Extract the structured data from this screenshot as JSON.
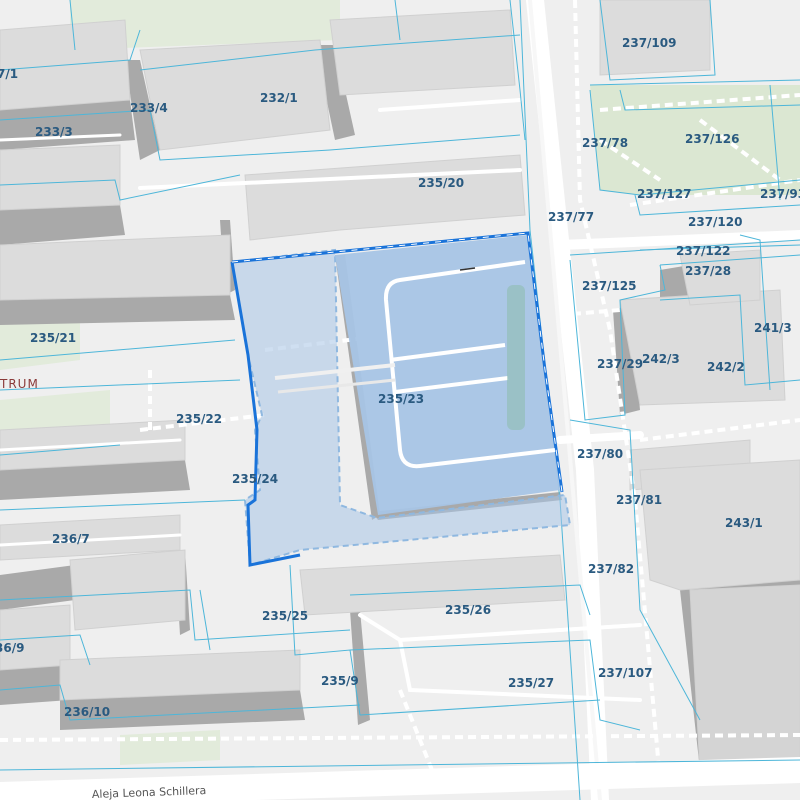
{
  "map": {
    "colors": {
      "background": "#efefef",
      "building_top": "#dcdcdc",
      "building_side": "#a9a9a9",
      "greenery": "#dbe7d2",
      "road": "#ffffff",
      "path": "#ffffff",
      "parcel_line": "#4db6d9",
      "selected_fill": "#a7c4e5",
      "selected_outline": "#1a73d9",
      "label": "#2a5a80"
    },
    "selected_parcel": "235/23",
    "district_label": "TRUM",
    "street_label": "Aleja Leona Schillera",
    "parcel_labels": [
      "237/109",
      "7/1",
      "233/4",
      "232/1",
      "233/3",
      "237/78",
      "237/126",
      "235/20",
      "237/127",
      "237/93",
      "237/77",
      "237/120",
      "237/122",
      "237/28",
      "237/125",
      "241/3",
      "235/21",
      "242/3",
      "237/29",
      "242/2",
      "235/23",
      "235/22",
      "237/80",
      "235/24",
      "237/81",
      "243/1",
      "236/7",
      "237/82",
      "235/25",
      "235/26",
      "36/9",
      "237/107",
      "235/9",
      "235/27",
      "236/10"
    ]
  }
}
